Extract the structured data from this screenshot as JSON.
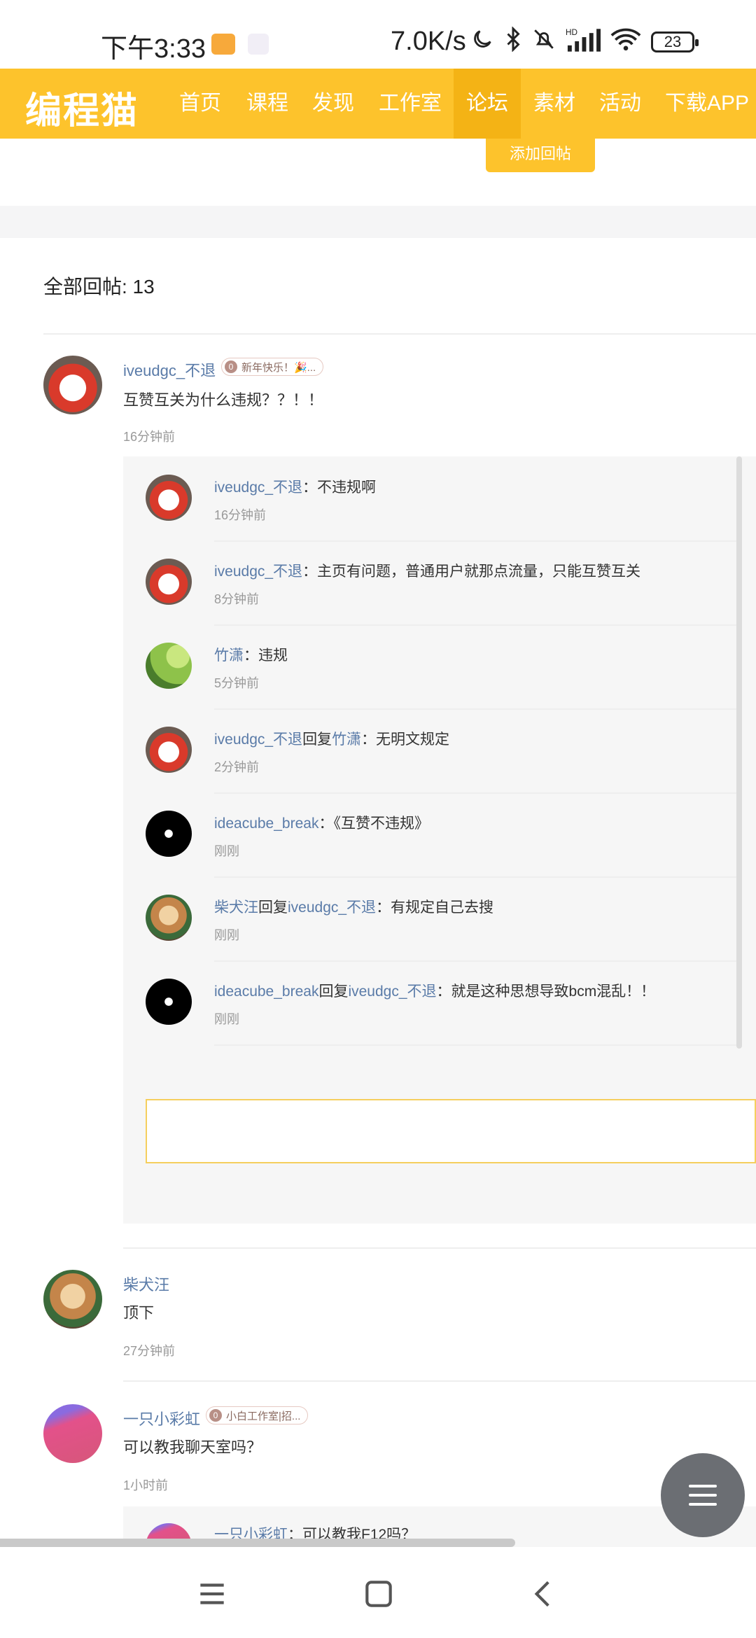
{
  "status_bar": {
    "time": "下午3:33",
    "network_speed": "7.0K/s",
    "battery": "23",
    "icons": [
      "message-app-icon",
      "app-icon",
      "moon-icon",
      "bluetooth-icon",
      "mute-icon",
      "signal-icon",
      "wifi-icon",
      "battery-icon"
    ]
  },
  "header": {
    "logo": "编程猫",
    "nav": [
      "首页",
      "课程",
      "发现",
      "工作室",
      "论坛",
      "素材",
      "活动",
      "下载APP"
    ],
    "active_nav": "论坛",
    "accent_color": "#fdc32c"
  },
  "add_reply_button": "添加回帖",
  "total_replies": "全部回帖: 13",
  "posts": [
    {
      "author": "iveudgc_不退",
      "badge_level": "0",
      "badge_text": "新年快乐！🎉...",
      "text": "互赞互关为什么违规？？！！",
      "time": "16分钟前",
      "replies": [
        {
          "user": "iveudgc_不退",
          "reply_word": "",
          "target": "",
          "text": "：不违规啊",
          "time": "16分钟前"
        },
        {
          "user": "iveudgc_不退",
          "reply_word": "",
          "target": "",
          "text": "：主页有问题，普通用户就那点流量，只能互赞互关",
          "time": "8分钟前"
        },
        {
          "user": "竹潇",
          "reply_word": "",
          "target": "",
          "text": "：违规",
          "time": "5分钟前"
        },
        {
          "user": "iveudgc_不退",
          "reply_word": "回复",
          "target": "竹潇",
          "text": "：无明文规定",
          "time": "2分钟前"
        },
        {
          "user": "ideacube_break",
          "reply_word": "",
          "target": "",
          "text": "：《互赞不违规》",
          "time": "刚刚"
        },
        {
          "user": "柴犬汪",
          "reply_word": "回复",
          "target": "iveudgc_不退",
          "text": "：有规定自己去搜",
          "time": "刚刚"
        },
        {
          "user": "ideacube_break",
          "reply_word": "回复",
          "target": "iveudgc_不退",
          "text": "：就是这种思想导致bcm混乱！！",
          "time": "刚刚"
        }
      ]
    },
    {
      "author": "柴犬汪",
      "text": "顶下",
      "time": "27分钟前"
    },
    {
      "author": "一只小彩虹",
      "badge_level": "0",
      "badge_text": "小白工作室|招...",
      "text": "可以教我聊天室吗？",
      "time": "1小时前",
      "replies": [
        {
          "user": "一只小彩虹",
          "text": "：可以教我F12吗？"
        }
      ]
    }
  ],
  "floating_menu_icon": "menu-icon",
  "system_nav": [
    "menu-icon",
    "home-icon",
    "back-icon"
  ]
}
